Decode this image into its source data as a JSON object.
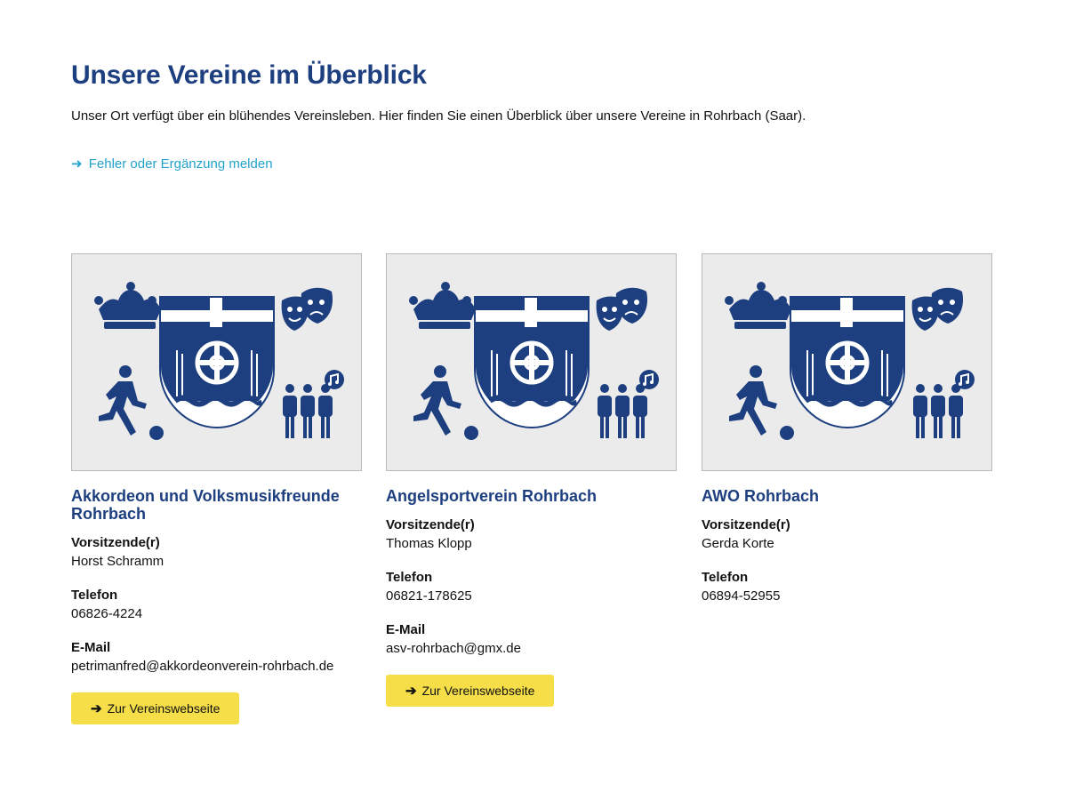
{
  "header": {
    "title": "Unsere Vereine im Überblick",
    "intro": "Unser Ort verfügt über ein blühendes Vereinsleben. Hier finden Sie einen Überblick über unsere Vereine in Rohrbach (Saar).",
    "report_link": "Fehler oder Ergänzung melden",
    "report_arrow": "➜"
  },
  "colors": {
    "brand_blue": "#1d3f7f",
    "link_cyan": "#22a3cc",
    "button_yellow": "#f5de48",
    "image_bg": "#ebebeb"
  },
  "labels": {
    "chair": "Vorsitzende(r)",
    "phone": "Telefon",
    "email": "E-Mail",
    "website_button": "Zur Vereinswebseite",
    "button_arrow": "➔"
  },
  "clubs": [
    {
      "name": "Akkordeon und Volksmusikfreunde Rohrbach",
      "chair": "Horst Schramm",
      "phone": "06826-4224",
      "email": "petrimanfred@akkordeonverein-rohrbach.de",
      "image_icon": "club-placeholder-coat-of-arms-icon"
    },
    {
      "name": "Angelsportverein Rohrbach",
      "chair": "Thomas Klopp",
      "phone": "06821-178625",
      "email": "asv-rohrbach@gmx.de",
      "image_icon": "club-placeholder-coat-of-arms-icon"
    },
    {
      "name": "AWO Rohrbach",
      "chair": "Gerda Korte",
      "phone": "06894-52955",
      "image_icon": "club-placeholder-coat-of-arms-icon"
    }
  ]
}
